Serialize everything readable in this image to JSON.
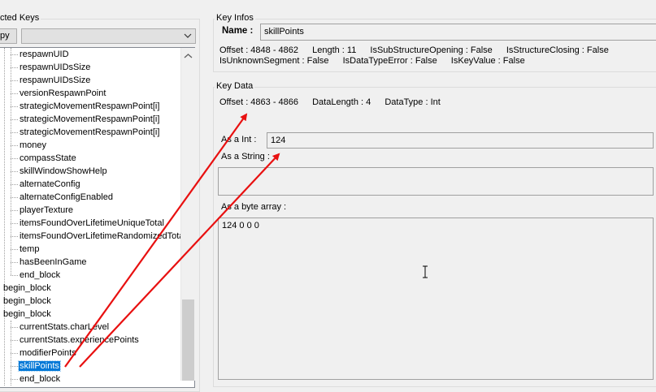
{
  "left_panel": {
    "group_title": "cted Keys",
    "copy_button": "py",
    "combo_value": "",
    "tree_items": [
      {
        "label": "respawnUID",
        "level": 2
      },
      {
        "label": "respawnUIDsSize",
        "level": 2
      },
      {
        "label": "respawnUIDsSize",
        "level": 2
      },
      {
        "label": "versionRespawnPoint",
        "level": 2
      },
      {
        "label": "strategicMovementRespawnPoint[i]",
        "level": 2
      },
      {
        "label": "strategicMovementRespawnPoint[i]",
        "level": 2
      },
      {
        "label": "strategicMovementRespawnPoint[i]",
        "level": 2
      },
      {
        "label": "money",
        "level": 2
      },
      {
        "label": "compassState",
        "level": 2
      },
      {
        "label": "skillWindowShowHelp",
        "level": 2
      },
      {
        "label": "alternateConfig",
        "level": 2
      },
      {
        "label": "alternateConfigEnabled",
        "level": 2
      },
      {
        "label": "playerTexture",
        "level": 2
      },
      {
        "label": "itemsFoundOverLifetimeUniqueTotal",
        "level": 2
      },
      {
        "label": "itemsFoundOverLifetimeRandomizedTotal",
        "level": 2
      },
      {
        "label": "temp",
        "level": 2
      },
      {
        "label": "hasBeenInGame",
        "level": 2
      },
      {
        "label": "end_block",
        "level": 2
      },
      {
        "label": "begin_block",
        "level": 1
      },
      {
        "label": "begin_block",
        "level": 1
      },
      {
        "label": "begin_block",
        "level": 1
      },
      {
        "label": "currentStats.charLevel",
        "level": 2
      },
      {
        "label": "currentStats.experiencePoints",
        "level": 2
      },
      {
        "label": "modifierPoints",
        "level": 2
      },
      {
        "label": "skillPoints",
        "level": 2,
        "selected": true
      },
      {
        "label": "end_block",
        "level": 2
      }
    ]
  },
  "key_infos": {
    "title": "Key Infos",
    "name_label": "Name :",
    "name_value": "skillPoints",
    "line1": [
      "Offset : 4848 - 4862",
      "Length : 11",
      "IsSubStructureOpening : False",
      "IsStructureClosing : False"
    ],
    "line2": [
      "IsUnknownSegment : False",
      "IsDataTypeError : False",
      "IsKeyValue : False"
    ]
  },
  "key_data": {
    "title": "Key Data",
    "line1": [
      "Offset : 4863 - 4866",
      "DataLength : 4",
      "DataType : Int"
    ],
    "as_int_label": "As a Int :",
    "as_int_value": "124",
    "as_string_label": "As a String :",
    "as_string_value": "",
    "as_bytes_label": "As a byte array :",
    "as_bytes_value": "124 0 0 0"
  },
  "annotation": {
    "arrow_color": "#e81010"
  }
}
